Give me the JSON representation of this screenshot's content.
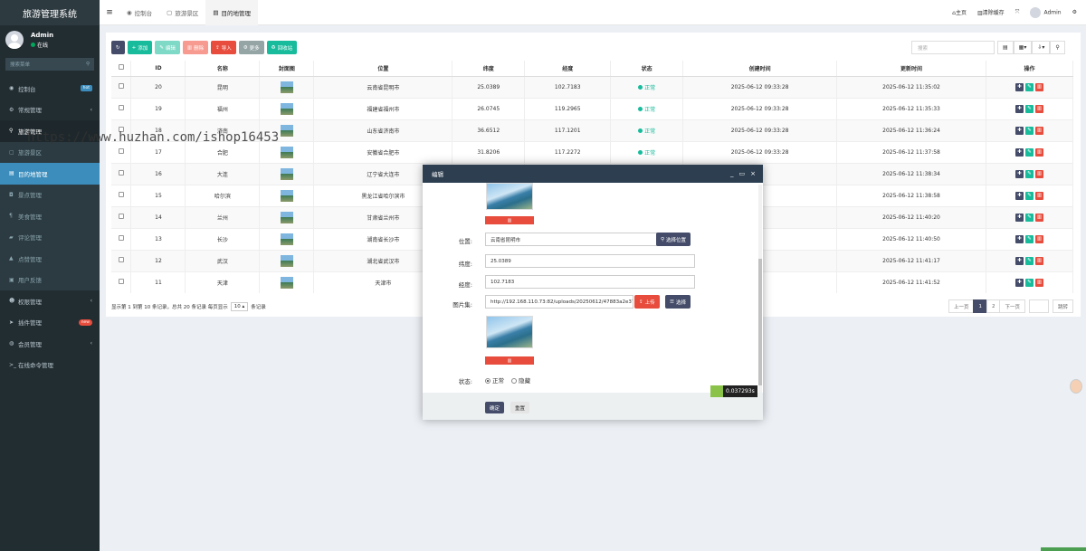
{
  "app": {
    "title": "旅游管理系统"
  },
  "user": {
    "name": "Admin",
    "status": "在线"
  },
  "sidebar": {
    "search_placeholder": "搜索菜单",
    "items": [
      {
        "label": "控制台",
        "icon": "dashboard-icon",
        "badge": "hot"
      },
      {
        "label": "常规管理",
        "icon": "cogs-icon"
      },
      {
        "label": "旅游管理",
        "icon": "map-pin-icon"
      },
      {
        "label": "旅游景区",
        "icon": "image-icon"
      },
      {
        "label": "目的地管理",
        "icon": "map-icon"
      },
      {
        "label": "景点管理",
        "icon": "camera-icon"
      },
      {
        "label": "美食管理",
        "icon": "cutlery-icon"
      },
      {
        "label": "评论管理",
        "icon": "comment-icon"
      },
      {
        "label": "点赞管理",
        "icon": "thumbs-up-icon"
      },
      {
        "label": "用户反馈",
        "icon": "feedback-icon"
      },
      {
        "label": "权限管理",
        "icon": "users-icon"
      },
      {
        "label": "插件管理",
        "icon": "rocket-icon",
        "badge": "new"
      },
      {
        "label": "会员管理",
        "icon": "user-circle-icon"
      },
      {
        "label": "在线命令管理",
        "icon": "terminal-icon"
      }
    ]
  },
  "topbar": {
    "tabs": [
      "控制台",
      "旅游景区",
      "目的地管理"
    ],
    "home": "主页",
    "clear_cache": "清除缓存",
    "user": "Admin"
  },
  "toolbar": {
    "add": "添加",
    "edit": "编辑",
    "delete": "删除",
    "import": "导入",
    "more": "更多",
    "recycle": "回收站",
    "search_placeholder": "搜索"
  },
  "table": {
    "headers": [
      "ID",
      "名称",
      "封面图",
      "位置",
      "纬度",
      "经度",
      "状态",
      "创建时间",
      "更新时间",
      "操作"
    ],
    "rows": [
      {
        "id": "20",
        "name": "昆明",
        "location": "云南省昆明市",
        "lat": "25.0389",
        "lng": "102.7183",
        "status": "正常",
        "created": "2025-06-12 09:33:28",
        "updated": "2025-06-12 11:35:02"
      },
      {
        "id": "19",
        "name": "福州",
        "location": "福建省福州市",
        "lat": "26.0745",
        "lng": "119.2965",
        "status": "正常",
        "created": "2025-06-12 09:33:28",
        "updated": "2025-06-12 11:35:33"
      },
      {
        "id": "18",
        "name": "济南",
        "location": "山东省济南市",
        "lat": "36.6512",
        "lng": "117.1201",
        "status": "正常",
        "created": "2025-06-12 09:33:28",
        "updated": "2025-06-12 11:36:24"
      },
      {
        "id": "17",
        "name": "合肥",
        "location": "安徽省合肥市",
        "lat": "31.8206",
        "lng": "117.2272",
        "status": "正常",
        "created": "2025-06-12 09:33:28",
        "updated": "2025-06-12 11:37:58"
      },
      {
        "id": "16",
        "name": "大连",
        "location": "辽宁省大连市",
        "lat": "",
        "lng": "",
        "status": "",
        "created": "",
        "updated": "2025-06-12 11:38:34"
      },
      {
        "id": "15",
        "name": "哈尔滨",
        "location": "黑龙江省哈尔滨市",
        "lat": "",
        "lng": "",
        "status": "",
        "created": "",
        "updated": "2025-06-12 11:38:58"
      },
      {
        "id": "14",
        "name": "兰州",
        "location": "甘肃省兰州市",
        "lat": "",
        "lng": "",
        "status": "",
        "created": "",
        "updated": "2025-06-12 11:40:20"
      },
      {
        "id": "13",
        "name": "长沙",
        "location": "湖南省长沙市",
        "lat": "",
        "lng": "",
        "status": "",
        "created": "",
        "updated": "2025-06-12 11:40:50"
      },
      {
        "id": "12",
        "name": "武汉",
        "location": "湖北省武汉市",
        "lat": "",
        "lng": "",
        "status": "",
        "created": "",
        "updated": "2025-06-12 11:41:17"
      },
      {
        "id": "11",
        "name": "天津",
        "location": "天津市",
        "lat": "",
        "lng": "",
        "status": "",
        "created": "",
        "updated": "2025-06-12 11:41:52"
      }
    ]
  },
  "pagination": {
    "summary": "显示第 1 到第 10 条记录，总共 20 条记录 每页显示",
    "page_size": "10",
    "suffix": "条记录",
    "prev": "上一页",
    "pages": [
      "1",
      "2"
    ],
    "next": "下一页",
    "jump": "跳转"
  },
  "watermark": "https://www.huzhan.com/ishop16453",
  "modal": {
    "title": "编辑",
    "location_label": "位置:",
    "location_value": "云南省昆明市",
    "choose_location": "选择位置",
    "lat_label": "纬度:",
    "lat_value": "25.0389",
    "lng_label": "经度:",
    "lng_value": "102.7183",
    "gallery_label": "图片集:",
    "gallery_value": "http://192.168.110.73:82/uploads/20250612/47883a2e37",
    "upload": "上传",
    "select": "选择",
    "status_label": "状态:",
    "status_normal": "正常",
    "status_hidden": "隐藏",
    "confirm": "确定",
    "reset": "重置"
  },
  "timer": "0.037293s"
}
